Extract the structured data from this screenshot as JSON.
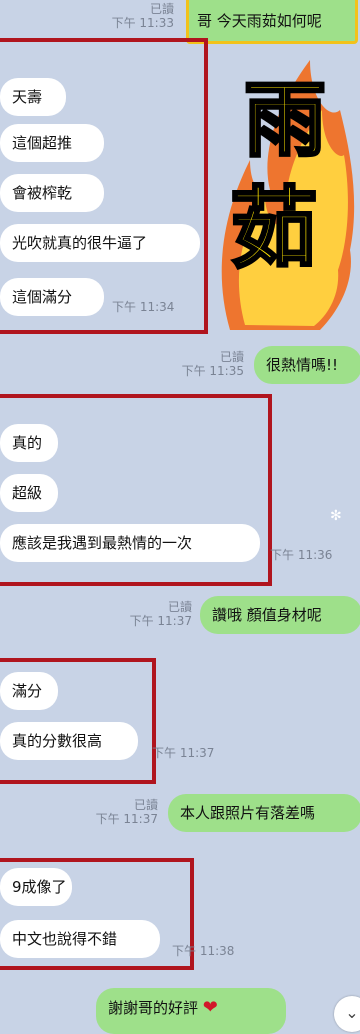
{
  "messages": [
    {
      "side": "out",
      "text": "哥 今天雨茹如何呢",
      "read": "已讀",
      "time": "下午 11:33"
    },
    {
      "side": "in",
      "text": "天壽"
    },
    {
      "side": "in",
      "text": "這個超推"
    },
    {
      "side": "in",
      "text": "會被榨乾"
    },
    {
      "side": "in",
      "text": "光吹就真的很牛逼了"
    },
    {
      "side": "in",
      "text": "這個滿分",
      "time": "下午 11:34"
    },
    {
      "side": "out",
      "text": "很熱情嗎!!",
      "read": "已讀",
      "time": "下午 11:35"
    },
    {
      "side": "in",
      "text": "真的"
    },
    {
      "side": "in",
      "text": "超級"
    },
    {
      "side": "in",
      "text": "應該是我遇到最熱情的一次",
      "time": "下午 11:36"
    },
    {
      "side": "out",
      "text": "讚哦 顏值身材呢",
      "read": "已讀",
      "time": "下午 11:37"
    },
    {
      "side": "in",
      "text": "滿分"
    },
    {
      "side": "in",
      "text": "真的分數很高",
      "time": "下午 11:37"
    },
    {
      "side": "out",
      "text": "本人跟照片有落差嗎",
      "read": "已讀",
      "time": "下午 11:37"
    },
    {
      "side": "in",
      "text": "9成像了"
    },
    {
      "side": "in",
      "text": "中文也說得不錯",
      "time": "下午 11:38"
    },
    {
      "side": "out",
      "text": "謝謝哥的好評"
    }
  ],
  "sticker": {
    "line1": "雨",
    "line2": "茹"
  },
  "colors": {
    "background": "#c8d3e6",
    "outgoing": "#9ee08a",
    "incoming": "#ffffff",
    "highlight_red": "#b0141e",
    "highlight_yellow": "#f2c21a"
  },
  "icons": [
    "heart-icon",
    "chevron-down-icon"
  ]
}
